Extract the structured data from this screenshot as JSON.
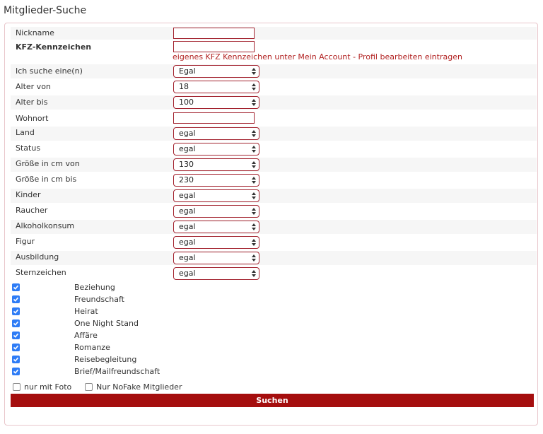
{
  "page": {
    "title": "Mitglieder-Suche"
  },
  "form": {
    "nickname_label": "Nickname",
    "nickname_value": "",
    "kfz_label": "KFZ-Kennzeichen",
    "kfz_value": "",
    "kfz_hint": "eigenes KFZ Kennzeichen unter Mein Account - Profil bearbeiten eintragen",
    "suche_label": "Ich suche eine(n)",
    "suche_value": "Egal",
    "alter_von_label": "Alter von",
    "alter_von_value": "18",
    "alter_bis_label": "Alter bis",
    "alter_bis_value": "100",
    "wohnort_label": "Wohnort",
    "wohnort_value": "",
    "land_label": "Land",
    "land_value": "egal",
    "status_label": "Status",
    "status_value": "egal",
    "groesse_von_label": "Größe in cm von",
    "groesse_von_value": "130",
    "groesse_bis_label": "Größe in cm bis",
    "groesse_bis_value": "230",
    "kinder_label": "Kinder",
    "kinder_value": "egal",
    "raucher_label": "Raucher",
    "raucher_value": "egal",
    "alkohol_label": "Alkoholkonsum",
    "alkohol_value": "egal",
    "figur_label": "Figur",
    "figur_value": "egal",
    "ausbildung_label": "Ausbildung",
    "ausbildung_value": "egal",
    "sternzeichen_label": "Sternzeichen",
    "sternzeichen_value": "egal"
  },
  "interests": [
    {
      "label": "Beziehung",
      "checked": true
    },
    {
      "label": "Freundschaft",
      "checked": true
    },
    {
      "label": "Heirat",
      "checked": true
    },
    {
      "label": "One Night Stand",
      "checked": true
    },
    {
      "label": "Affäre",
      "checked": true
    },
    {
      "label": "Romanze",
      "checked": true
    },
    {
      "label": "Reisebegleitung",
      "checked": true
    },
    {
      "label": "Brief/Mailfreundschaft",
      "checked": true
    }
  ],
  "filters": {
    "foto_label": "nur mit Foto",
    "foto_checked": false,
    "nofake_label": "Nur NoFake Mitglieder",
    "nofake_checked": false
  },
  "submit_label": "Suchen",
  "colors": {
    "accent": "#a50e0e",
    "border": "#a3232f",
    "checkbox": "#2e7cf6",
    "hint": "#b22222"
  }
}
